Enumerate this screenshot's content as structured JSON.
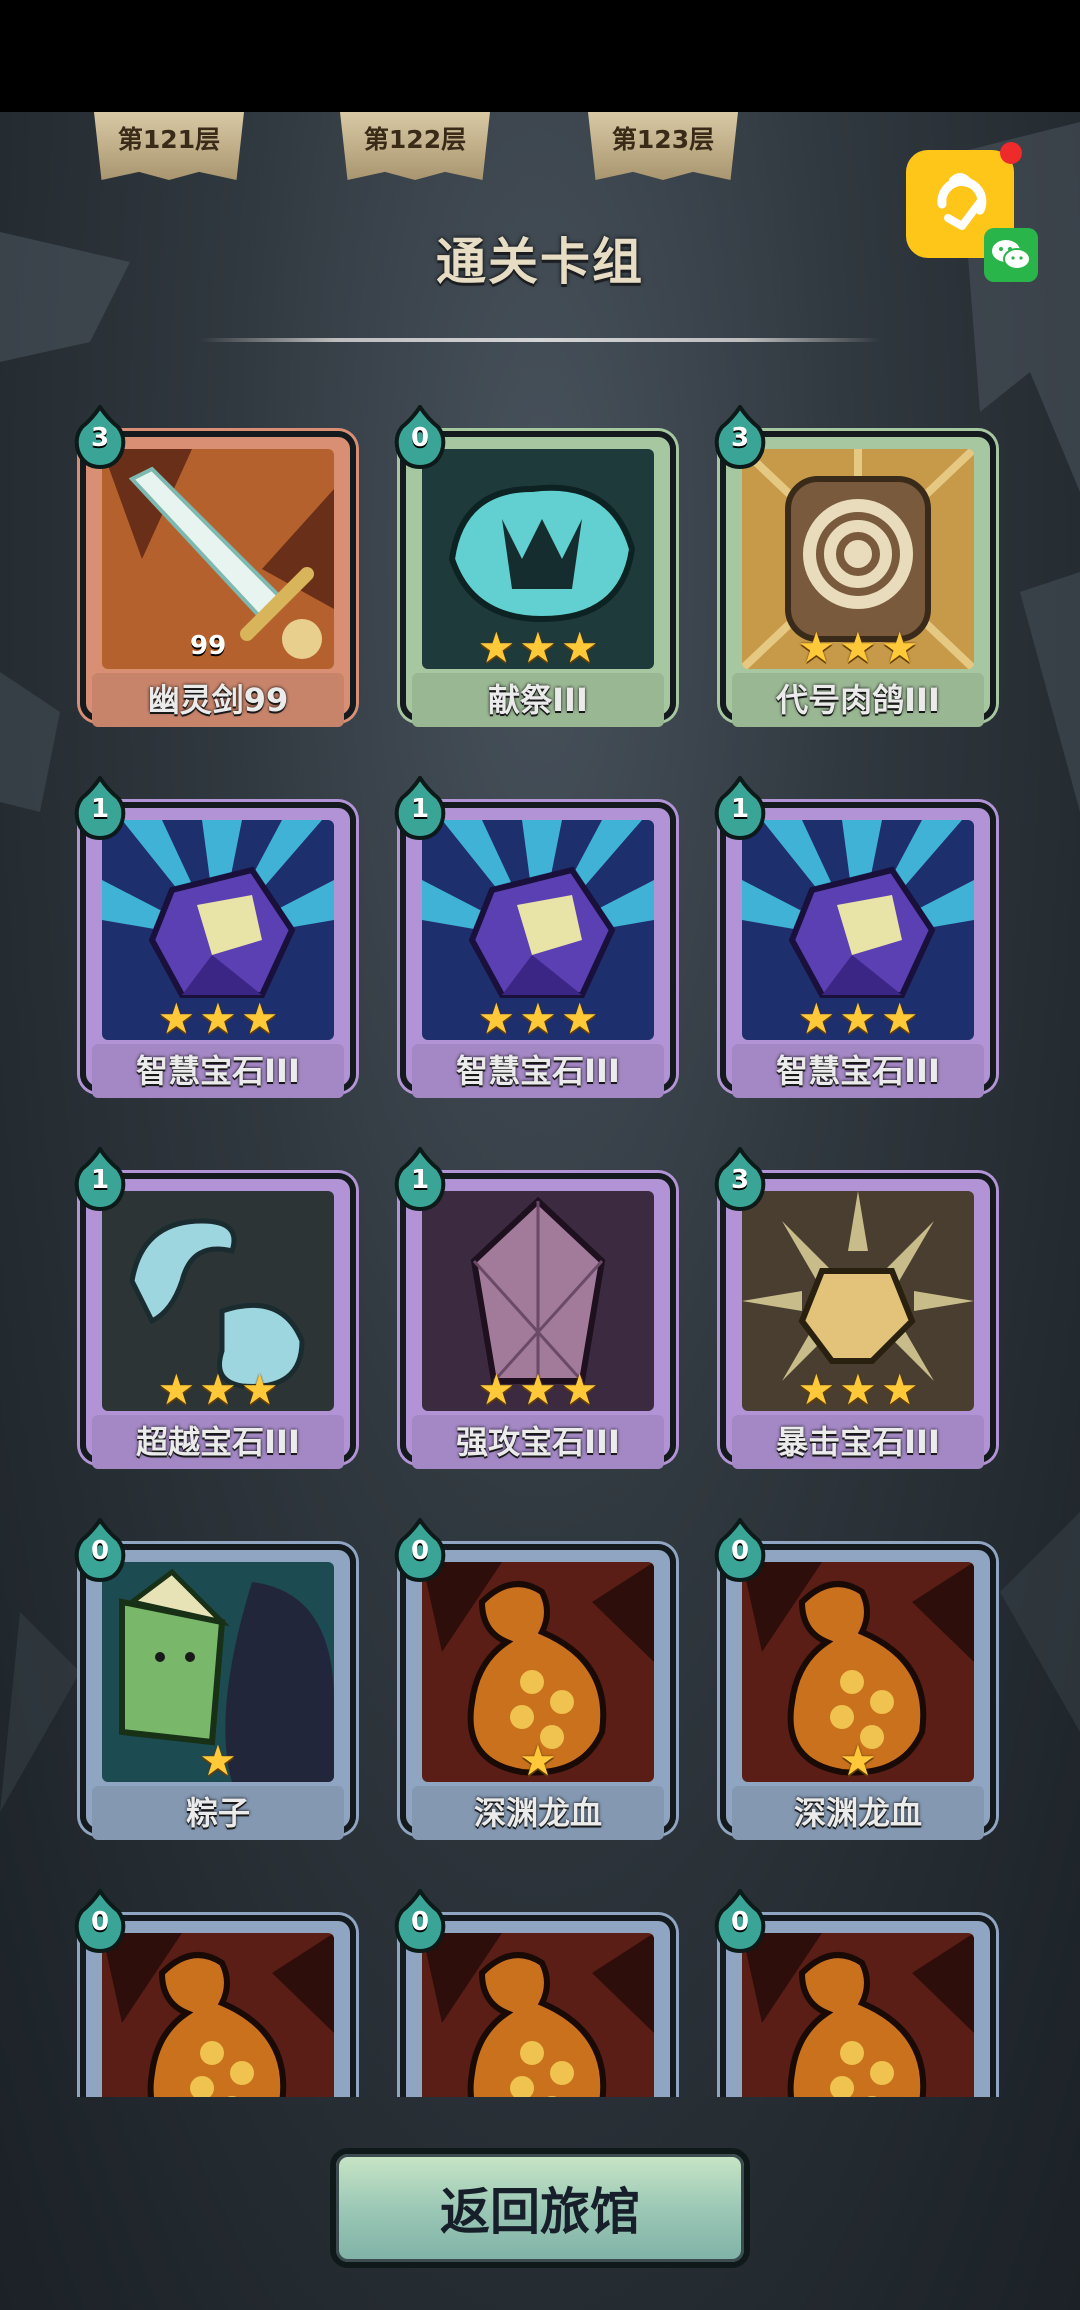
{
  "floors": [
    "第121层",
    "第122层",
    "第123层"
  ],
  "title": "通关卡组",
  "buttons": {
    "return": "返回旅馆"
  },
  "cards": [
    {
      "cost": "3",
      "name": "幽灵剑99",
      "level": "99",
      "stars": 0,
      "rarity": "orange",
      "art": "sword-icon"
    },
    {
      "cost": "0",
      "name": "献祭III",
      "stars": 3,
      "rarity": "green",
      "art": "sacrifice-icon"
    },
    {
      "cost": "3",
      "name": "代号肉鸽III",
      "stars": 3,
      "rarity": "green",
      "art": "codename-icon"
    },
    {
      "cost": "1",
      "name": "智慧宝石III",
      "stars": 3,
      "rarity": "purple",
      "art": "wisdom-gem-icon"
    },
    {
      "cost": "1",
      "name": "智慧宝石III",
      "stars": 3,
      "rarity": "purple",
      "art": "wisdom-gem-icon"
    },
    {
      "cost": "1",
      "name": "智慧宝石III",
      "stars": 3,
      "rarity": "purple",
      "art": "wisdom-gem-icon"
    },
    {
      "cost": "1",
      "name": "超越宝石III",
      "stars": 3,
      "rarity": "purple",
      "art": "transcend-gem-icon"
    },
    {
      "cost": "1",
      "name": "强攻宝石III",
      "stars": 3,
      "rarity": "purple",
      "art": "assault-gem-icon"
    },
    {
      "cost": "3",
      "name": "暴击宝石III",
      "stars": 3,
      "rarity": "purple",
      "art": "crit-gem-icon"
    },
    {
      "cost": "0",
      "name": "粽子",
      "stars": 1,
      "rarity": "blue",
      "art": "zongzi-icon"
    },
    {
      "cost": "0",
      "name": "深渊龙血",
      "stars": 1,
      "rarity": "blue",
      "art": "dragon-blood-icon"
    },
    {
      "cost": "0",
      "name": "深渊龙血",
      "stars": 1,
      "rarity": "blue",
      "art": "dragon-blood-icon"
    },
    {
      "cost": "0",
      "name": "",
      "stars": 0,
      "rarity": "blue",
      "art": "dragon-blood-icon"
    },
    {
      "cost": "0",
      "name": "",
      "stars": 0,
      "rarity": "blue",
      "art": "dragon-blood-icon"
    },
    {
      "cost": "0",
      "name": "",
      "stars": 0,
      "rarity": "blue",
      "art": "dragon-blood-icon"
    }
  ],
  "colors": {
    "orange": "#d88f74",
    "green": "#a7c7a0",
    "purple": "#b294d6",
    "blue": "#8fa5c1",
    "star": "#ffc93a",
    "cost_drop": "#3aa596"
  }
}
